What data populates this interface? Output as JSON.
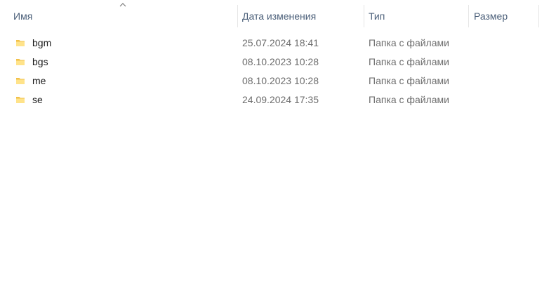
{
  "columns": {
    "name": "Имя",
    "date": "Дата изменения",
    "type": "Тип",
    "size": "Размер"
  },
  "sort": {
    "column": "name",
    "icon": "chevron-up-icon"
  },
  "files": [
    {
      "name": "bgm",
      "date": "25.07.2024 18:41",
      "type": "Папка с файлами",
      "size": "",
      "icon": "folder-icon"
    },
    {
      "name": "bgs",
      "date": "08.10.2023 10:28",
      "type": "Папка с файлами",
      "size": "",
      "icon": "folder-icon"
    },
    {
      "name": "me",
      "date": "08.10.2023 10:28",
      "type": "Папка с файлами",
      "size": "",
      "icon": "folder-icon"
    },
    {
      "name": "se",
      "date": "24.09.2024 17:35",
      "type": "Папка с файлами",
      "size": "",
      "icon": "folder-icon"
    }
  ],
  "colors": {
    "header_text": "#4c607a",
    "folder_light": "#ffe38a",
    "folder_dark": "#f2c14a"
  }
}
